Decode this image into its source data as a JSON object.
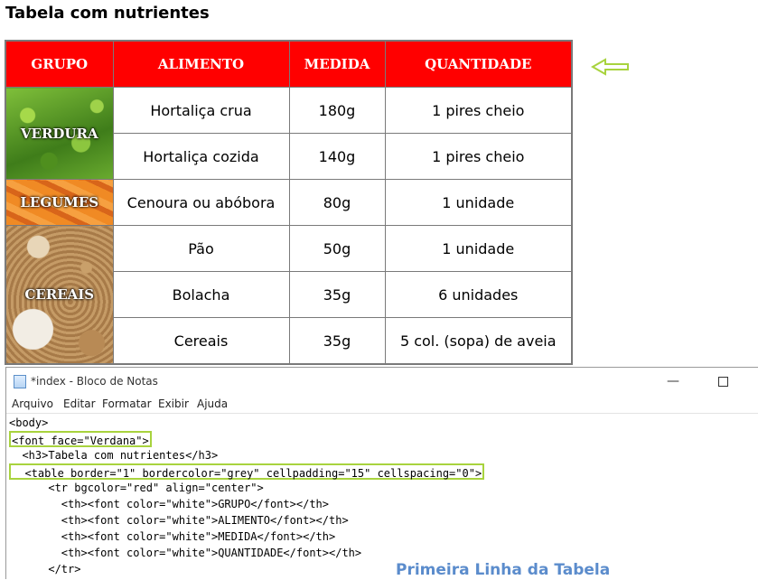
{
  "page": {
    "title": "Tabela com nutrientes"
  },
  "table": {
    "headers": [
      "GRUPO",
      "ALIMENTO",
      "MEDIDA",
      "QUANTIDADE"
    ],
    "groups": [
      "VERDURA",
      "LEGUMES",
      "CEREAIS"
    ],
    "rows": [
      {
        "alimento": "Hortaliça crua",
        "medida": "180g",
        "quantidade": "1 pires cheio"
      },
      {
        "alimento": "Hortaliça cozida",
        "medida": "140g",
        "quantidade": "1 pires cheio"
      },
      {
        "alimento": "Cenoura ou abóbora",
        "medida": "80g",
        "quantidade": "1 unidade"
      },
      {
        "alimento": "Pão",
        "medida": "50g",
        "quantidade": "1 unidade"
      },
      {
        "alimento": "Bolacha",
        "medida": "35g",
        "quantidade": "6 unidades"
      },
      {
        "alimento": "Cereais",
        "medida": "35g",
        "quantidade": "5 col. (sopa) de aveia"
      }
    ]
  },
  "notepad": {
    "title": "*index - Bloco de Notas",
    "menu": [
      "Arquivo",
      "Editar",
      "Formatar",
      "Exibir",
      "Ajuda"
    ],
    "lines": [
      "<body>",
      "<font face=\"Verdana\">",
      "  <h3>Tabela com nutrientes</h3>",
      "  <table border=\"1\" bordercolor=\"grey\" cellpadding=\"15\" cellspacing=\"0\">",
      "      <tr bgcolor=\"red\" align=\"center\">",
      "        <th><font color=\"white\">GRUPO</font></th>",
      "        <th><font color=\"white\">ALIMENTO</font></th>",
      "        <th><font color=\"white\">MEDIDA</font></th>",
      "        <th><font color=\"white\">QUANTIDADE</font></th>",
      "      </tr>"
    ],
    "annotation": "Primeira Linha da Tabela"
  },
  "icons": {
    "arrow": "left-arrow-outline-icon",
    "app": "notepad-icon"
  },
  "colors": {
    "header_bg": "#ff0000",
    "border": "#7a7a7a",
    "highlight": "#a8d33e",
    "annotation": "#5b8ccc"
  }
}
